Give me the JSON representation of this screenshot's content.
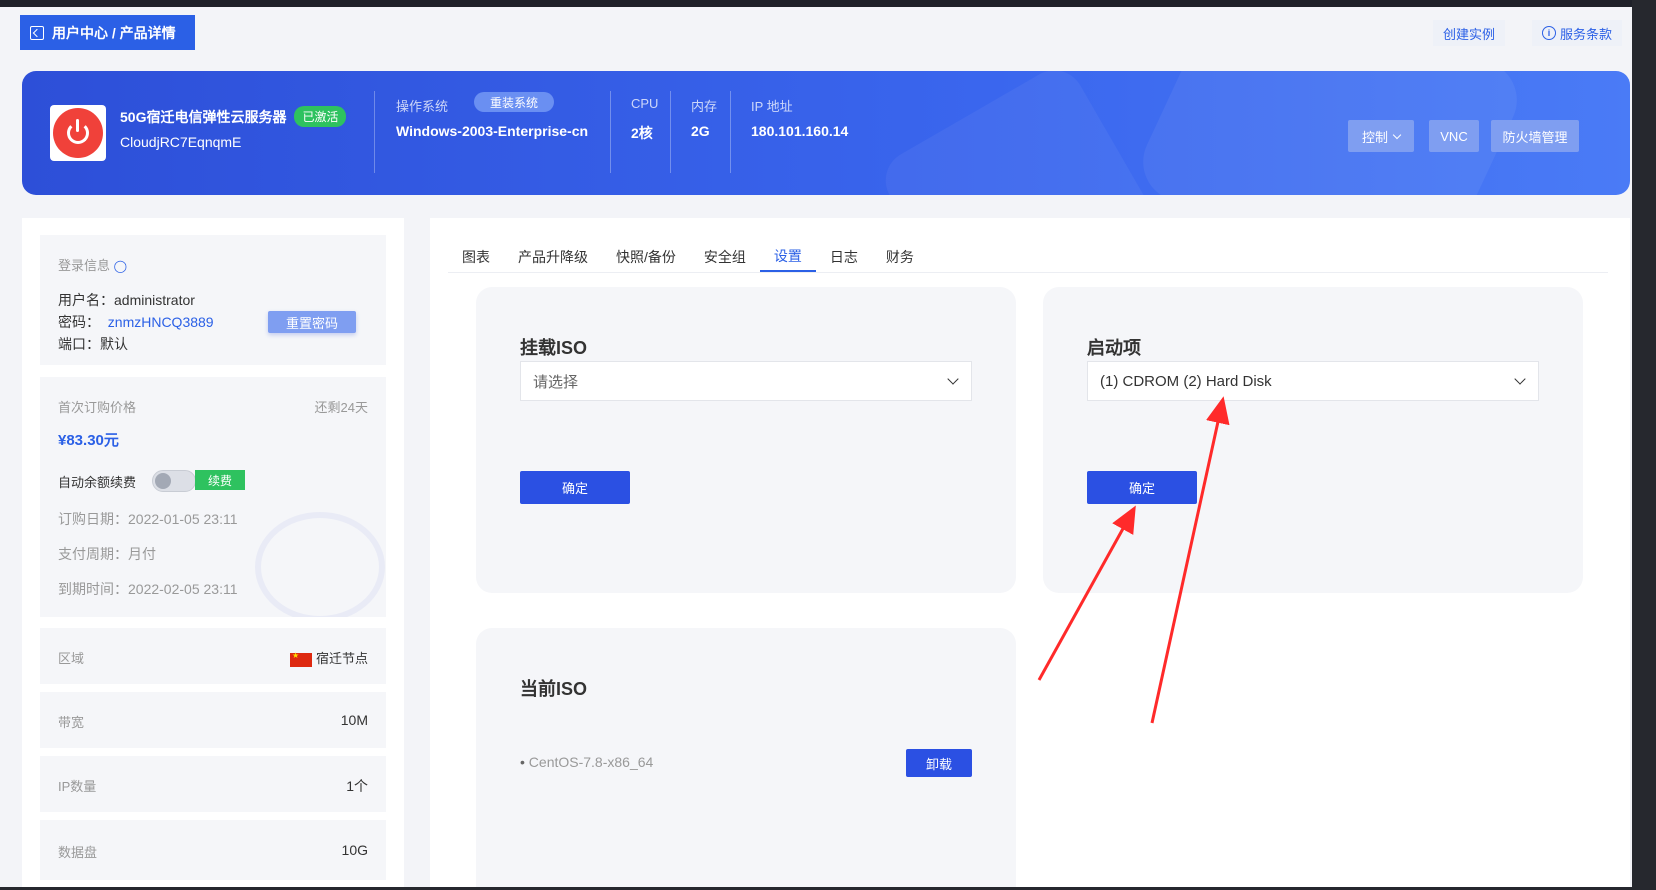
{
  "breadcrumb": "用户中心 / 产品详情",
  "top_links": {
    "create_instance": "创建实例",
    "terms": "服务条款"
  },
  "banner": {
    "server_name": "50G宿迁电信弹性云服务器",
    "status": "已激活",
    "server_id": "CloudjRC7EqnqmE",
    "os_label": "操作系统",
    "reinstall": "重装系统",
    "os_value": "Windows-2003-Enterprise-cn",
    "cpu_label": "CPU",
    "cpu_value": "2核",
    "mem_label": "内存",
    "mem_value": "2G",
    "ip_label": "IP 地址",
    "ip_value": "180.101.160.14",
    "control": "控制",
    "vnc": "VNC",
    "firewall": "防火墙管理"
  },
  "login": {
    "title": "登录信息",
    "username_label": "用户名：",
    "username": "administrator",
    "password_label": "密码：",
    "password": "znmzHNCQ3889",
    "port_label": "端口：",
    "port": "默认",
    "reset": "重置密码"
  },
  "billing": {
    "first_price_label": "首次订购价格",
    "remaining": "还剩24天",
    "price": "¥83.30元",
    "auto_renew": "自动余额续费",
    "renew": "续费",
    "order_date": "订购日期：2022-01-05 23:11",
    "pay_cycle": "支付周期：月付",
    "expire": "到期时间：2022-02-05 23:11"
  },
  "specs": [
    {
      "label": "区域",
      "value": "宿迁节点"
    },
    {
      "label": "带宽",
      "value": "10M"
    },
    {
      "label": "IP数量",
      "value": "1个"
    },
    {
      "label": "数据盘",
      "value": "10G"
    }
  ],
  "tabs": [
    "图表",
    "产品升降级",
    "快照/备份",
    "安全组",
    "设置",
    "日志",
    "财务"
  ],
  "active_tab": "设置",
  "mount_iso": {
    "title": "挂载ISO",
    "placeholder": "请选择",
    "confirm": "确定"
  },
  "boot": {
    "title": "启动项",
    "value": "(1) CDROM (2) Hard Disk",
    "confirm": "确定"
  },
  "current_iso": {
    "title": "当前ISO",
    "item": "CentOS-7.8-x86_64",
    "unmount": "卸载"
  },
  "colors": {
    "primary": "#2b50e3",
    "banner": "#3a66ee",
    "success": "#2ec25f",
    "danger": "#f0413a",
    "annotation": "#ff2a2a"
  }
}
